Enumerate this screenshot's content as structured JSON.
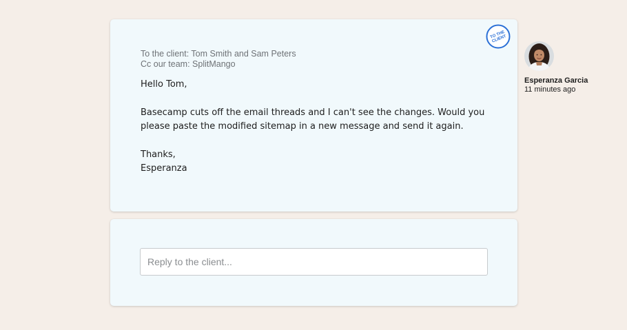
{
  "message": {
    "to_line": "To the client: Tom Smith and Sam Peters",
    "cc_line": "Cc our team: SplitMango",
    "greeting": "Hello Tom,",
    "body_line1": "Basecamp cuts off the email threads and I can't see the changes. Would you",
    "body_line2": "please paste the modified sitemap in a new message and send it again.",
    "signoff": "Thanks,",
    "signature": "Esperanza",
    "stamp_text": "TO THE CLIENT",
    "stamp_line1": "TO THE",
    "stamp_line2": "CLIENT"
  },
  "author": {
    "name": "Esperanza Garcia",
    "time": "11 minutes ago"
  },
  "reply": {
    "placeholder": "Reply to the client..."
  },
  "colors": {
    "background": "#f5eee8",
    "card": "#f1f9fc",
    "stamp": "#2a6fd6"
  }
}
